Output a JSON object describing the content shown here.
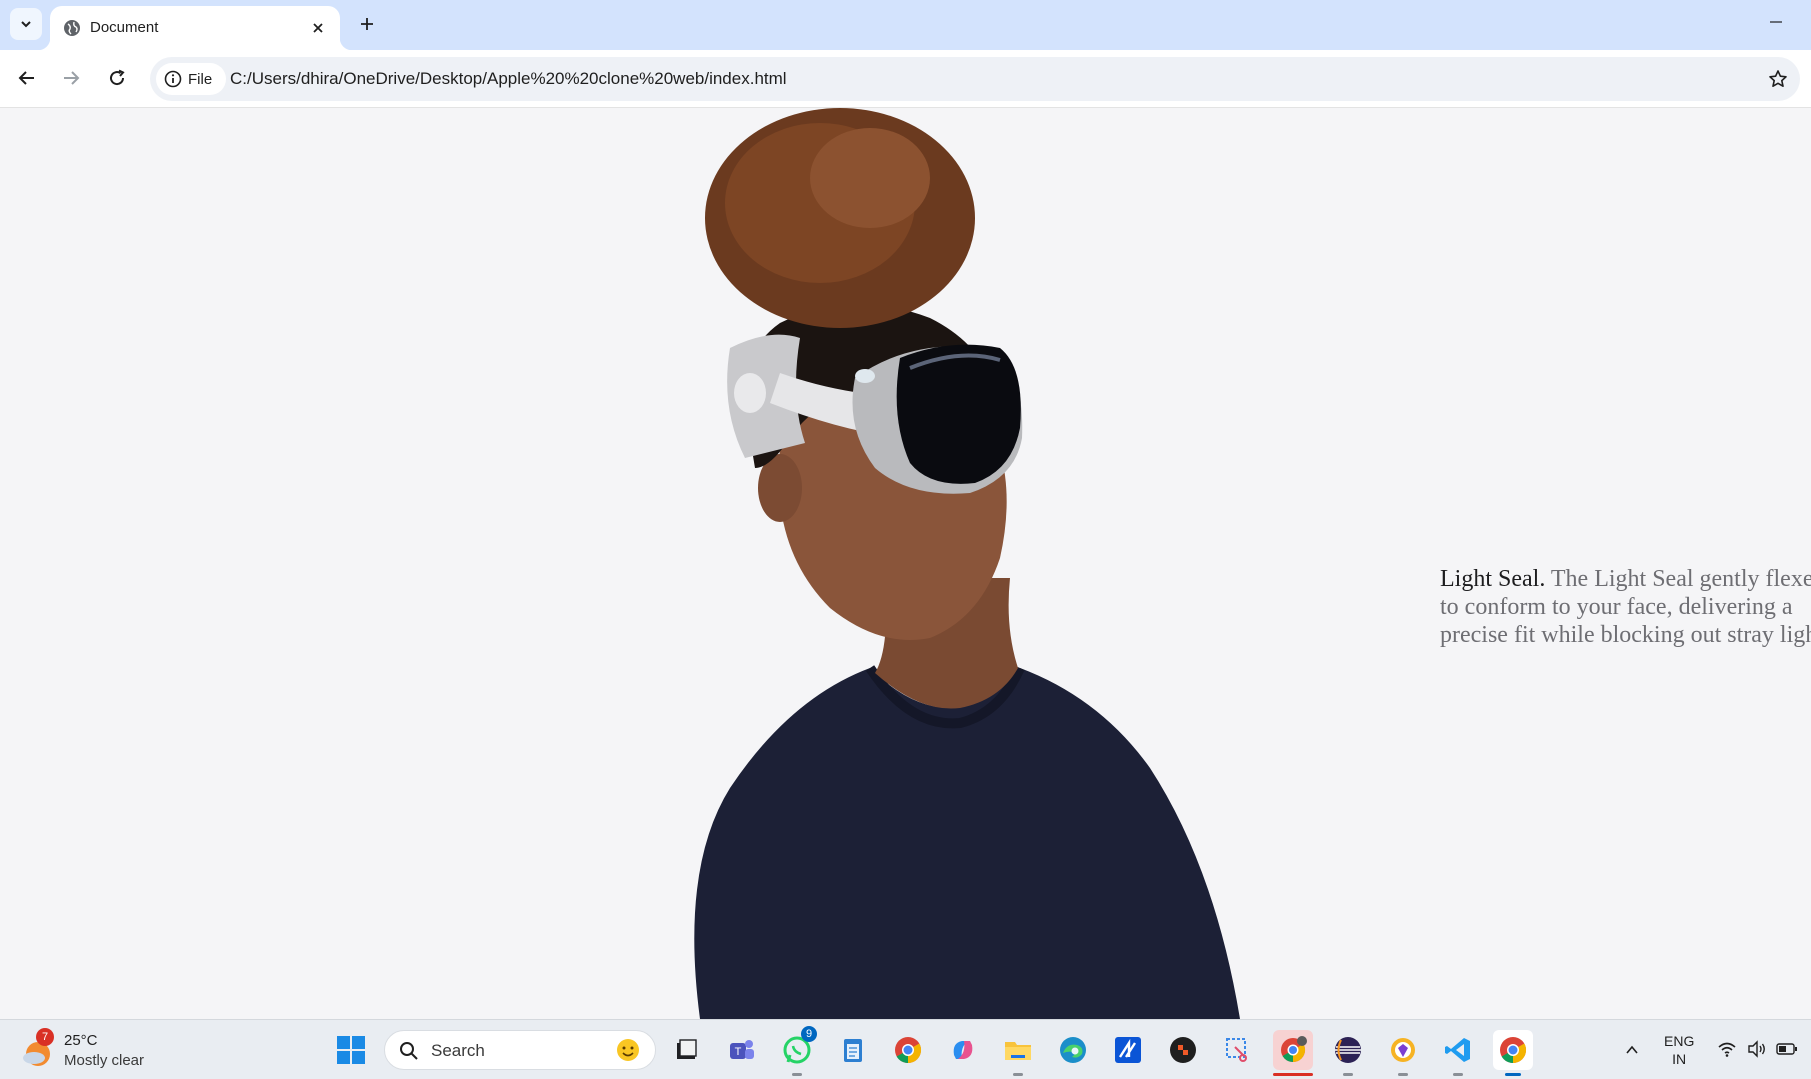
{
  "browser": {
    "tab_title": "Document",
    "omnibox_chip": "File",
    "url": "C:/Users/dhira/OneDrive/Desktop/Apple%20%20clone%20web/index.html",
    "icons": [
      "chevron-down-icon",
      "globe-icon",
      "close-icon",
      "plus-icon",
      "minimize-icon",
      "back-arrow-icon",
      "forward-arrow-icon",
      "reload-icon",
      "info-icon",
      "star-icon"
    ]
  },
  "page": {
    "feature_lead": "Light Seal.",
    "feature_body": " The Light Seal gently flexes to conform to your face, delivering a precise fit while blocking out stray light.",
    "background_color": "#f5f5f7"
  },
  "taskbar": {
    "weather_badge": "7",
    "weather_temp": "25°C",
    "weather_desc": "Mostly clear",
    "search_label": "Search",
    "whatsapp_badge": "9",
    "lang_line1": "ENG",
    "lang_line2": "IN",
    "apps": [
      "file-explorer-icon",
      "teams-icon",
      "whatsapp-icon",
      "notepad-icon",
      "chrome-icon",
      "copilot-icon",
      "folder-icon",
      "edge-icon",
      "autodesk-icon",
      "dark-app-icon",
      "snipping-tool-icon",
      "chrome-profile-icon",
      "eclipse-icon",
      "brave-icon",
      "vscode-icon",
      "chrome-active-icon"
    ]
  }
}
